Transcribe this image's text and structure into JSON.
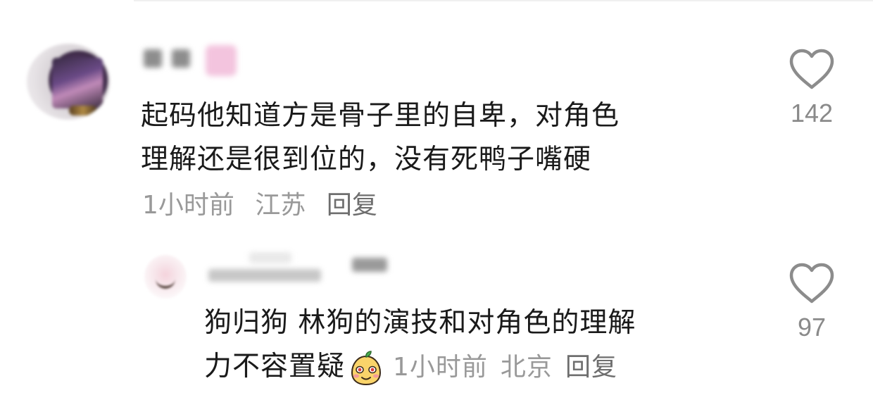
{
  "comments": [
    {
      "text_line1": "起码他知道方是骨子里的自卑，对角色",
      "text_line2": "理解还是很到位的，没有死鸭子嘴硬",
      "time": "1小时前",
      "location": "江苏",
      "reply_label": "回复",
      "like_count": "142",
      "like_icon": "heart-outline-icon"
    },
    {
      "text_line1": "狗归狗 林狗的演技和对角色的理解",
      "text_line2": "力不容置疑",
      "emoji": "smiling-mango-emoji",
      "time": "1小时前",
      "location": "北京",
      "reply_label": "回复",
      "like_count": "97",
      "like_icon": "heart-outline-icon"
    }
  ],
  "colors": {
    "text": "#1a1a1a",
    "meta": "#999999",
    "icon": "#8c8c8c"
  }
}
